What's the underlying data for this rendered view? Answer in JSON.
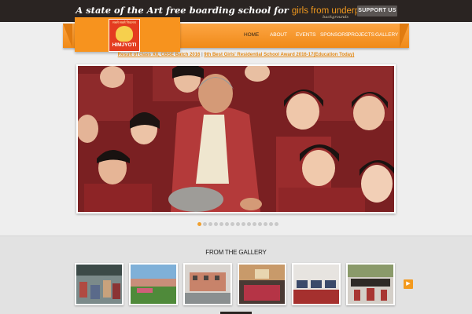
{
  "header": {
    "tagline_main": "A state of the Art free boarding school for ",
    "tagline_highlight": "girls from underprivileged",
    "tagline_small": "backgrounds",
    "support_button": "SUPPORT US"
  },
  "logo": {
    "top_text": "सबसे सबसे निकलना",
    "name": "HIMJYOTI"
  },
  "nav": {
    "items": [
      {
        "label": "HOME",
        "active": true
      },
      {
        "label": "ABOUT",
        "active": false
      },
      {
        "label": "EVENTS",
        "active": false
      },
      {
        "label": "SPONSORS",
        "active": false
      },
      {
        "label": "PROJECTS",
        "active": false
      },
      {
        "label": "GALLERY",
        "active": false
      }
    ]
  },
  "news": {
    "link1": "Result of class XII, CBSE Batch 2016",
    "separator": "|",
    "link2": "9th Best Girls' Residential School Award 2016-17(Education Today)"
  },
  "slider": {
    "slide_count": 15,
    "active_index": 0,
    "colors": {
      "active": "#f0a030",
      "inactive": "#c9c9c9"
    }
  },
  "gallery": {
    "title": "FROM THE GALLERY",
    "thumbnails": [
      {
        "name": "gallery-thumb-1",
        "scene": "group-outdoor"
      },
      {
        "name": "gallery-thumb-2",
        "scene": "campus-lawn"
      },
      {
        "name": "gallery-thumb-3",
        "scene": "school-building"
      },
      {
        "name": "gallery-thumb-4",
        "scene": "auditorium"
      },
      {
        "name": "gallery-thumb-5",
        "scene": "computer-lab"
      },
      {
        "name": "gallery-thumb-6",
        "scene": "assembly"
      }
    ],
    "next_icon": "arrow-right-icon"
  },
  "colors": {
    "accent": "#f7931e",
    "topbar": "#2a2422",
    "link": "#e38a18"
  }
}
